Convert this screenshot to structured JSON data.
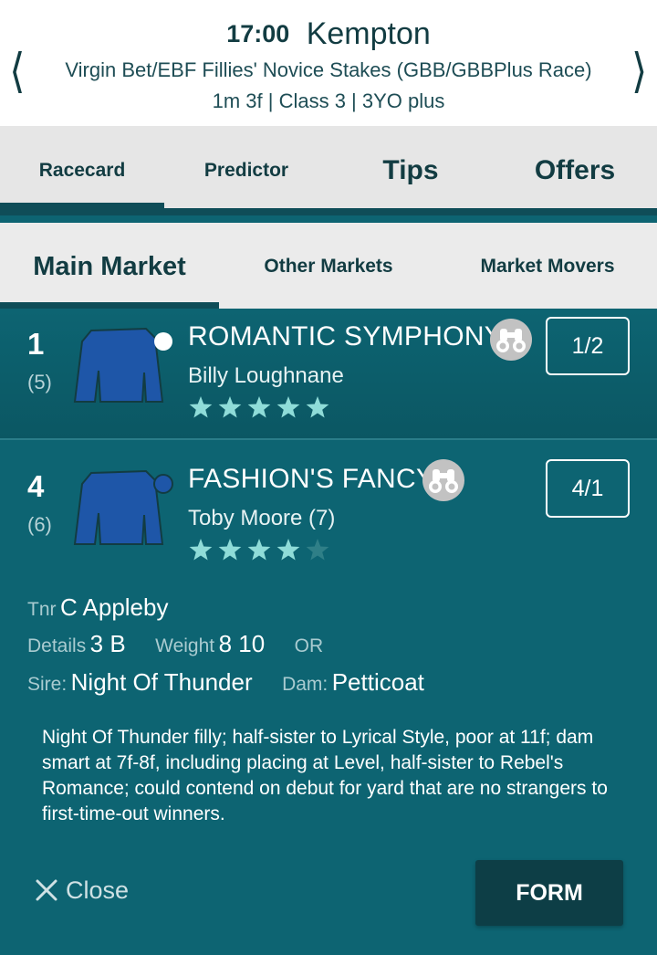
{
  "race": {
    "time": "17:00",
    "course": "Kempton",
    "name": "Virgin Bet/EBF Fillies' Novice Stakes (GBB/GBBPlus Race)",
    "info": "1m 3f | Class 3 | 3YO plus",
    "prev_icon": "chevron-left-icon",
    "next_icon": "chevron-right-icon"
  },
  "tabs": [
    {
      "label": "Racecard",
      "active": true
    },
    {
      "label": "Predictor",
      "active": false
    },
    {
      "label": "Tips",
      "active": false
    },
    {
      "label": "Offers",
      "active": false
    }
  ],
  "subtabs": [
    {
      "label": "Main Market",
      "active": true
    },
    {
      "label": "Other Markets",
      "active": false
    },
    {
      "label": "Market Movers",
      "active": false
    }
  ],
  "runners": [
    {
      "number": "1",
      "draw": "(5)",
      "name": "ROMANTIC SYMPHONY",
      "jockey": "Billy Loughnane",
      "rating_stars": 5,
      "odds": "1/2",
      "silks_color": "#1e56a8",
      "cap_color": "#ffffff",
      "icon": "binoculars-icon"
    },
    {
      "number": "4",
      "draw": "(6)",
      "name": "FASHION'S FANCY",
      "jockey": "Toby Moore (7)",
      "rating_stars": 4,
      "odds": "4/1",
      "silks_color": "#1e56a8",
      "cap_color": "#1e56a8",
      "icon": "binoculars-icon",
      "expanded": {
        "trainer_label": "Tnr",
        "trainer": "C Appleby",
        "details_label": "Details",
        "details": "3 B",
        "weight_label": "Weight",
        "weight": "8 10",
        "or_label": "OR",
        "or_value": "",
        "sire_label": "Sire:",
        "sire": "Night Of Thunder",
        "dam_label": "Dam:",
        "dam": "Petticoat",
        "comment": "Night Of Thunder filly; half-sister to Lyrical Style, poor at 11f; dam smart at 7f-8f, including placing at Level, half-sister to Rebel's Romance; could contend on debut for yard that are no strangers to first-time-out winners.",
        "close_label": "Close",
        "form_label": "FORM"
      }
    }
  ],
  "colors": {
    "background": "#0d6472",
    "header_text": "#123c42",
    "star_filled": "#8fdcd8",
    "star_empty": "#2f7f87"
  }
}
